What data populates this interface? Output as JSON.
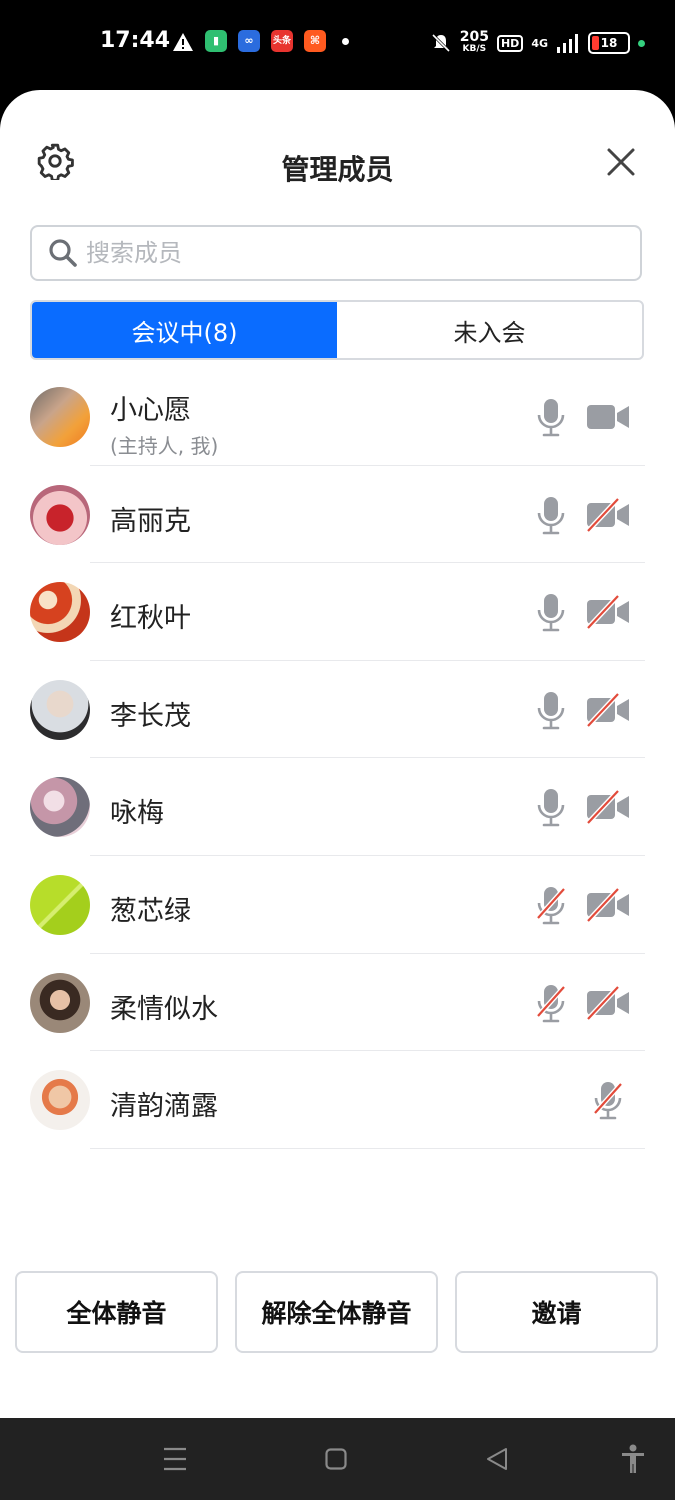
{
  "status_bar": {
    "time": "17:44",
    "speed_value": "205",
    "speed_unit": "KB/S",
    "hd": "HD",
    "network": "4G",
    "battery": "18",
    "app_icons": [
      "alert-icon",
      "battery-app-icon",
      "infinity-app-icon",
      "toutiao-app-icon",
      "kuaishou-app-icon"
    ],
    "toutiao_label": "头条"
  },
  "header": {
    "title": "管理成员"
  },
  "search": {
    "placeholder": "搜索成员"
  },
  "tabs": [
    {
      "label": "会议中(8)",
      "active": true
    },
    {
      "label": "未入会",
      "active": false
    }
  ],
  "members": [
    {
      "name": "小心愿",
      "sub": "(主持人, 我)",
      "mic": "on",
      "cam": "on"
    },
    {
      "name": "高丽克",
      "mic": "on",
      "cam": "off"
    },
    {
      "name": "红秋叶",
      "mic": "on",
      "cam": "off"
    },
    {
      "name": "李长茂",
      "mic": "on",
      "cam": "off"
    },
    {
      "name": "咏梅",
      "mic": "on",
      "cam": "off"
    },
    {
      "name": "葱芯绿",
      "mic": "off",
      "cam": "off"
    },
    {
      "name": "柔情似水",
      "mic": "off",
      "cam": "off"
    },
    {
      "name": "清韵滴露",
      "mic": "off",
      "cam": "none"
    }
  ],
  "actions": {
    "mute_all": "全体静音",
    "unmute_all": "解除全体静音",
    "invite": "邀请"
  },
  "colors": {
    "accent": "#0a6cff",
    "icon_gray": "#9a9da3",
    "off_red": "#e24b3b"
  }
}
